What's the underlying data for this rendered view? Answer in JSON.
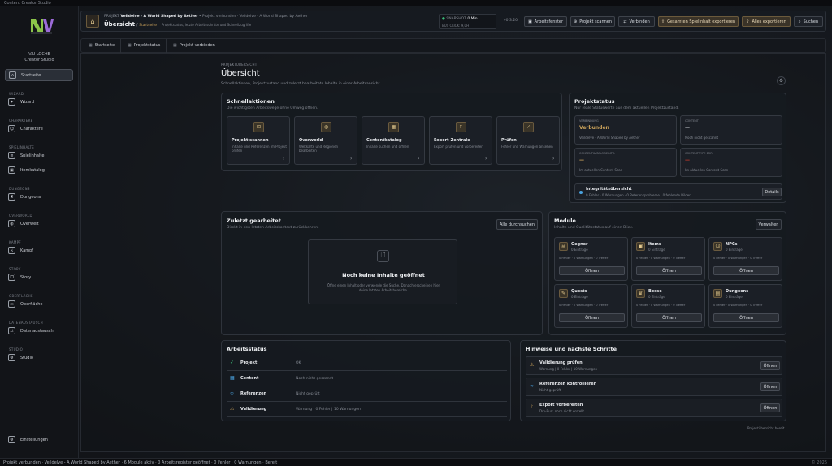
{
  "window_title": "Content Creator Studio",
  "sidebar": {
    "brand_line1": "V.U LOCHE",
    "brand_line2": "Creator Studio",
    "items": [
      {
        "section": "",
        "label": "Startseite",
        "icon": "home-icon"
      },
      {
        "section": "WIZARD",
        "label": "Wizard",
        "icon": "wand-icon"
      },
      {
        "section": "CHARAKTERE",
        "label": "Charaktere",
        "icon": "user-icon"
      },
      {
        "section": "SPIELINHALTE",
        "label": "Spielinhalte",
        "icon": "list-icon"
      },
      {
        "section": "",
        "label": "Itemkatalog",
        "icon": "box-icon"
      },
      {
        "section": "DUNGEONS",
        "label": "Dungeons",
        "icon": "castle-icon"
      },
      {
        "section": "OVERWORLD",
        "label": "Overwelt",
        "icon": "globe-icon"
      },
      {
        "section": "KAMPF",
        "label": "Kampf",
        "icon": "sword-icon"
      },
      {
        "section": "STORY",
        "label": "Story",
        "icon": "book-icon"
      },
      {
        "section": "OBERFLÄCHE",
        "label": "Oberfläche",
        "icon": "layout-icon"
      },
      {
        "section": "DATENAUSTAUSCH",
        "label": "Datenaustausch",
        "icon": "exchange-icon"
      },
      {
        "section": "STUDIO",
        "label": "Studio",
        "icon": "gear-icon"
      }
    ],
    "settings_label": "Einstellungen"
  },
  "header": {
    "project_prefix": "PROJEKT",
    "project_name": "Veildelve - A World Shaped by Aether",
    "project_meta": "• Projekt verbunden · Veildelve - A World Shaped by Aether",
    "page_title": "Übersicht",
    "crumb": "Startseite",
    "page_sub": "Projektstatus, letzte Arbeitsschritte und Schnellzugriffe",
    "snapshot_label": "SNAPSHOT",
    "snapshot_value": "0 Min",
    "snapshot_sub": "BUS CLICK: 9,0H",
    "version": "v0.3.20",
    "buttons": [
      "Arbeitsfenster",
      "Projekt scannen",
      "Verbinden",
      "Gesamten Spielinhalt exportieren",
      "Alles exportieren",
      "Suchen"
    ]
  },
  "tabs": [
    "Startseite",
    "Projektstatus",
    "Projekt verbinden"
  ],
  "page": {
    "kicker": "PROJEKTÜBERSICHT",
    "title": "Übersicht",
    "subtitle": "Schnellaktionen, Projektzustand und zuletzt bearbeitete Inhalte in einer Arbeitsansicht."
  },
  "quick": {
    "title": "Schnellaktionen",
    "sub": "Die wichtigsten Arbeitswege ohne Umweg öffnen.",
    "cards": [
      {
        "title": "Projekt scannen",
        "desc": "Inhalte und Referenzen im Projekt prüfen",
        "icon": "scan-icon"
      },
      {
        "title": "Overworld",
        "desc": "Weltkarte und Regionen bearbeiten",
        "icon": "globe-icon"
      },
      {
        "title": "Contentkatalog",
        "desc": "Inhalte suchen und öffnen",
        "icon": "grid-icon"
      },
      {
        "title": "Export-Zentrale",
        "desc": "Export prüfen und vorbereiten",
        "icon": "export-icon"
      },
      {
        "title": "Prüfen",
        "desc": "Fehler und Warnungen ansehen",
        "icon": "check-icon"
      }
    ]
  },
  "status": {
    "title": "Projektstatus",
    "sub": "Nur reale Statuswerte aus dem aktuellen Projektzustand.",
    "tiles": [
      {
        "label": "VERBINDUNG",
        "value": "Verbunden",
        "desc": "Veildelve - A World Shaped by Aether",
        "accent": "#c9a15a"
      },
      {
        "label": "CONTENT",
        "value": "—",
        "desc": "Noch nicht gescannt",
        "accent": "#c9ccd2"
      },
      {
        "label": "CONTENTKATALOGEINTR.",
        "value": "—",
        "desc": "Im aktuellen Content-Scan",
        "accent": "#c9a15a"
      },
      {
        "label": "CONTENTTYPE ERR",
        "value": "—",
        "desc": "Im aktuellen Content-Scan",
        "accent": "#c0392b"
      }
    ],
    "integrity_title": "Integritätsübersicht",
    "integrity_desc": "0 Fehler · 0 Warnungen · 0 Referenzprobleme · 0 fehlende Bilder",
    "details_label": "Details"
  },
  "recent": {
    "title": "Zuletzt gearbeitet",
    "sub": "Direkt in den letzten Arbeitskontext zurückkehren.",
    "button": "Alle durchsuchen",
    "empty_title": "Noch keine Inhalte geöffnet",
    "empty_desc": "Öffne einen Inhalt oder verwende die Suche. Danach erscheinen hier deine letzten Arbeitsbereiche."
  },
  "modules": {
    "title": "Module",
    "sub": "Inhalte und Qualitätsstatus auf einen Blick.",
    "button": "Verwalten",
    "items": [
      {
        "name": "Gegner",
        "count": "0 Einträge",
        "stats": "0 Fehler · 0 Warnungen · 0 Treffer",
        "action": "Öffnen",
        "icon": "skull-icon"
      },
      {
        "name": "Items",
        "count": "0 Einträge",
        "stats": "0 Fehler · 0 Warnungen · 0 Treffer",
        "action": "Öffnen",
        "icon": "box-icon"
      },
      {
        "name": "NPCs",
        "count": "0 Einträge",
        "stats": "0 Fehler · 0 Warnungen · 0 Treffer",
        "action": "Öffnen",
        "icon": "user-icon"
      },
      {
        "name": "Quests",
        "count": "0 Einträge",
        "stats": "0 Fehler · 0 Warnungen · 0 Treffer",
        "action": "Öffnen",
        "icon": "scroll-icon"
      },
      {
        "name": "Bosse",
        "count": "0 Einträge",
        "stats": "0 Fehler · 0 Warnungen · 0 Treffer",
        "action": "Öffnen",
        "icon": "crown-icon"
      },
      {
        "name": "Dungeons",
        "count": "0 Einträge",
        "stats": "0 Fehler · 0 Warnungen · 0 Treffer",
        "action": "Öffnen",
        "icon": "folder-icon"
      }
    ]
  },
  "work": {
    "title": "Arbeitsstatus",
    "rows": [
      {
        "label": "Projekt",
        "value": "OK",
        "icon": "check-icon"
      },
      {
        "label": "Content",
        "value": "Noch nicht gescannt",
        "icon": "grid-icon"
      },
      {
        "label": "Referenzen",
        "value": "Nicht geprüft",
        "icon": "link-icon"
      },
      {
        "label": "Validierung",
        "value": "Warnung | 0 Fehler | 10 Warnungen",
        "icon": "warning-icon"
      }
    ]
  },
  "hints": {
    "title": "Hinweise und nächste Schritte",
    "items": [
      {
        "title": "Validierung prüfen",
        "desc": "Warnung | 0 Fehler | 10 Warnungen",
        "action": "Öffnen",
        "icon": "warning-icon"
      },
      {
        "title": "Referenzen kontrollieren",
        "desc": "Nicht geprüft",
        "action": "Öffnen",
        "icon": "link-icon"
      },
      {
        "title": "Export vorbereiten",
        "desc": "Dry-Run: noch nicht erstellt",
        "action": "Öffnen",
        "icon": "export-icon"
      }
    ],
    "footer": "Projektübersicht bereit"
  },
  "statusbar": {
    "text": "Projekt verbunden · Veildelve - A World Shaped by Aether · 6 Module aktiv · 0 Arbeitsregister geöffnet · 0 Fehler · 0 Warnungen · Bereit",
    "right": "© 2026"
  }
}
